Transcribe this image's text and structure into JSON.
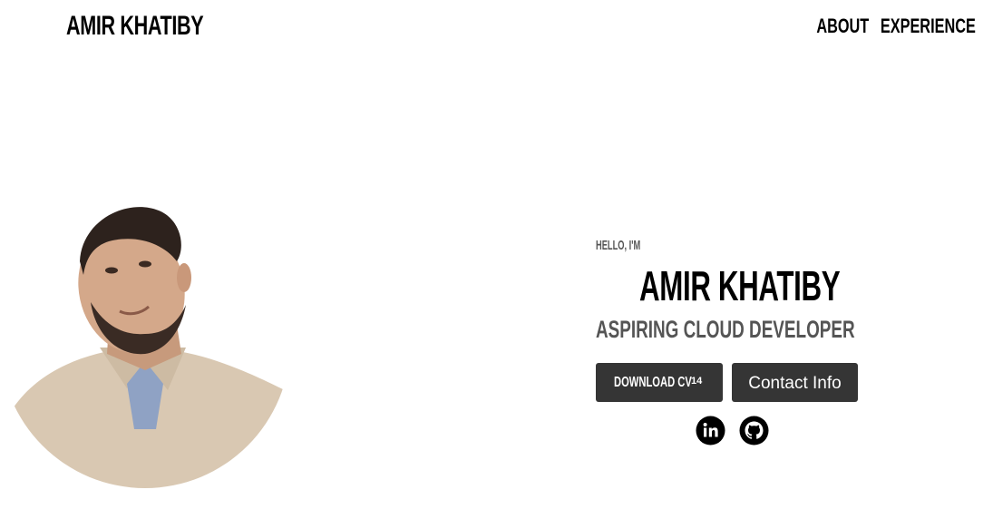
{
  "header": {
    "logo": "AMIR KHATIBY",
    "nav": {
      "about": "ABOUT",
      "experience": "EXPERIENCE"
    }
  },
  "hero": {
    "greeting": "HELLO, I'M",
    "name": "AMIR KHATIBY",
    "title": "ASPIRING CLOUD DEVELOPER",
    "download_cv_label": "DOWNLOAD CV",
    "download_cv_count": "14",
    "contact_label": "Contact Info",
    "profile_photo": "profile-photo"
  },
  "socials": {
    "linkedin": "linkedin-icon",
    "github": "github-icon"
  },
  "colors": {
    "background": "#ffffff",
    "button": "#353535",
    "text_primary": "#000000",
    "text_secondary": "#555555"
  }
}
